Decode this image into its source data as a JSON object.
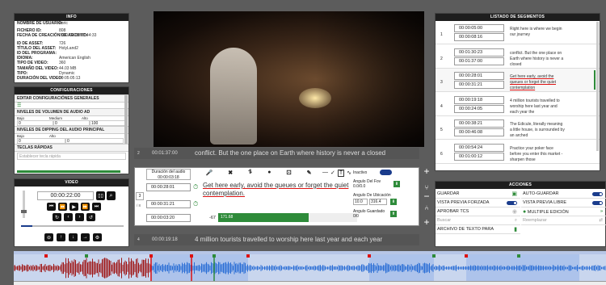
{
  "info": {
    "title": "INFO",
    "rows": [
      {
        "k": "NOMBRE DE USUARIO:",
        "v": "enric"
      },
      {
        "k": "FICHERO ID:",
        "v": "808"
      },
      {
        "k": "FECHA DE CREACIÓN DE ARCHIVO:",
        "v": "2020-03-02 12:44:33"
      },
      {
        "k": "ID DE ASSET:",
        "v": "726"
      },
      {
        "k": "TÍTULO DEL ASSET:",
        "v": "HolyLand2"
      },
      {
        "k": "ID DEL PROGRAMA:",
        "v": ""
      },
      {
        "k": "IDIOMA:",
        "v": "American English"
      },
      {
        "k": "TIPO DE VIDEO:",
        "v": "360"
      },
      {
        "k": "TAMAÑO DEL VIDEO:",
        "v": "44.03 MB"
      },
      {
        "k": "TIPO:",
        "v": "Dynamic"
      },
      {
        "k": "DURACIÓN DEL VIDEO:",
        "v": "00:05:05:13"
      }
    ]
  },
  "config": {
    "title": "CONFIGURACIONES",
    "general": "EDITAR CONFIGURACIÓNES GENERALES",
    "audio_ad": "NIVELES DE VOLUMEN DE AUDIO AD",
    "bajo": "Bajo",
    "medio": "Medium",
    "alto": "Alto",
    "ad_vals": [
      "0",
      "0",
      "100"
    ],
    "dipping": "NIVELES DE DIPPING DEL AUDIO PRINCIPAL",
    "dip_vals": [
      "0",
      "0"
    ],
    "teclas": "TECLAS RÁPIDAS",
    "teclas_ph": "Establecer tecla rápida"
  },
  "video": {
    "title": "VIDEO",
    "time": "00:00:22:00"
  },
  "editor": {
    "prev_time": "00:01:37:00",
    "prev_text": "conflict. But the one place on Earth where history is never a closed",
    "dur_label": "Duración del audio",
    "dur_value": "00:00:03:18",
    "in_time": "00:00:28:01",
    "out_time": "00:00:31:21",
    "text": "Get here early, avoid the queues or forget the quiet contemplation.",
    "gap_time": "00:00:03:20",
    "gap_val": "-67",
    "bar_val": "171.68",
    "inactivo": "Inactivo",
    "fov_label": "Angulo Del Fov",
    "fov_val": "0.0/0.0",
    "ubic_label": "Angulo De Ubicación",
    "ubic_a": "10.0",
    "ubic_b": "316.4",
    "guard_label": "Angulo Guardado",
    "guard_val": "0/0",
    "seg_index": "3",
    "seg_total": "/ 8",
    "next_time": "00:00:19:18",
    "next_text": "4 million tourists travelled to worship here last year and each year",
    "row_nums": [
      "2",
      "3",
      "4"
    ]
  },
  "segments": {
    "title": "LISTADO DE SEGMENTOS",
    "items": [
      {
        "n": "1",
        "a": "00:00:05:00",
        "b": "00:00:08:16",
        "t": "Right here is where we begin our journey"
      },
      {
        "n": "2",
        "a": "00:01:30:23",
        "b": "00:01:37:00",
        "t": "conflict. But the one place on Earth where history is never a closed"
      },
      {
        "n": "3",
        "a": "00:00:28:01",
        "b": "00:00:31:21",
        "t": "Get here early, avoid the queues or forget the quiet contemplation"
      },
      {
        "n": "4",
        "a": "00:00:19:18",
        "b": "00:00:24:05",
        "t": "4 million tourists travelled to worship here last year and each year the"
      },
      {
        "n": "5",
        "a": "00:00:38:21",
        "b": "00:00:46:08",
        "t": "The Edicule, literally meaning a little house, is surrounded by an arched"
      },
      {
        "n": "6",
        "a": "00:00:54:24",
        "b": "00:01:00:12",
        "t": "Practice your poker face before you enter this market - sharpen those"
      }
    ]
  },
  "actions": {
    "title": "ACCIONES",
    "guardar": "GUARDAR",
    "auto": "AUTO-GUARDAR",
    "forzada": "VISTA PREVIA FORZADA",
    "libre": "VISTA PREVIA LIBRE",
    "aprobar": "APROBAR TCS",
    "multiple": "MULTIPLE EDICIÓN",
    "buscar": "Buscar",
    "reemplazar": "Reemplazar",
    "archivo": "ARCHIVO DE TEXTO PARA"
  },
  "colors": {
    "accent": "#1a3c8c",
    "green": "#2e8b3a",
    "red": "#d11",
    "wave_red": "#a01818",
    "wave_blue": "#2c6fd6"
  }
}
